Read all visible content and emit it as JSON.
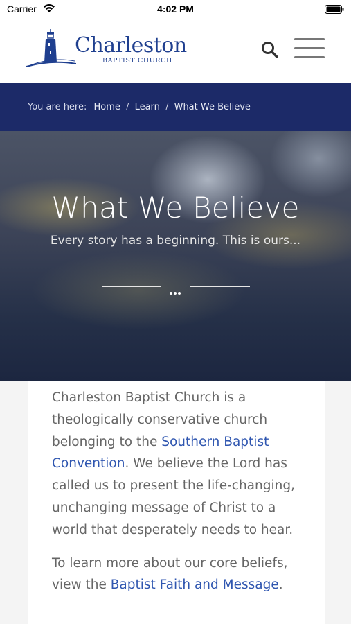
{
  "status_bar": {
    "carrier": "Carrier",
    "time": "4:02 PM"
  },
  "header": {
    "logo_name": "Charleston",
    "logo_sub": "BAPTIST CHURCH",
    "brand_color": "#1f3f8f"
  },
  "breadcrumb": {
    "prefix": "You are here:",
    "items": [
      "Home",
      "Learn",
      "What We Believe"
    ],
    "separator": "/",
    "bar_color": "#1c2a68"
  },
  "hero": {
    "title": "What We Believe",
    "subtitle": "Every story has a beginning. This is ours..."
  },
  "content": {
    "p1_before": "Charleston Baptist Church is a theologically conservative church belonging to the ",
    "p1_link": "Southern Baptist Convention",
    "p1_after": ". We believe the Lord has called us to present the life-changing, unchanging message of Christ to a world that desperately needs to hear.",
    "p2_before": "To learn more about our core beliefs, view the ",
    "p2_link": "Baptist Faith and Message",
    "p2_after": ".",
    "link_color": "#2f56b0"
  }
}
